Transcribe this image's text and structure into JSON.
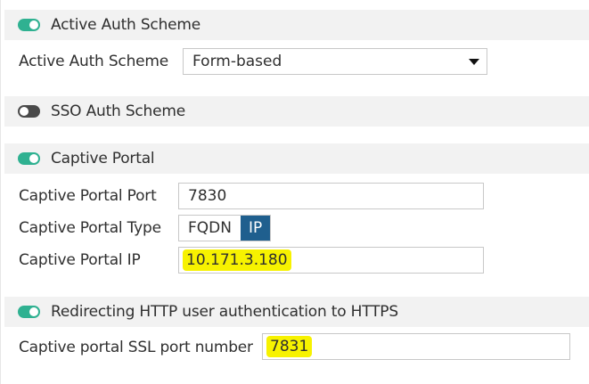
{
  "active_auth": {
    "header": "Active Auth Scheme",
    "toggle": "on",
    "label": "Active Auth Scheme",
    "value": "Form-based"
  },
  "sso_auth": {
    "header": "SSO Auth Scheme",
    "toggle": "off"
  },
  "captive_portal": {
    "header": "Captive Portal",
    "toggle": "on",
    "port_label": "Captive Portal Port",
    "port_value": "7830",
    "type_label": "Captive Portal Type",
    "type_options": [
      "FQDN",
      "IP"
    ],
    "type_selected": "IP",
    "ip_label": "Captive Portal IP",
    "ip_value": "10.171.3.180"
  },
  "redirect_https": {
    "header": "Redirecting HTTP user authentication to HTTPS",
    "toggle": "on",
    "ssl_port_label": "Captive portal SSL port number",
    "ssl_port_value": "7831"
  },
  "colors": {
    "toggle_on": "#2fb191",
    "toggle_off": "#4a4a4a",
    "segment_active": "#1f5f8e",
    "highlight": "#f7f200"
  }
}
